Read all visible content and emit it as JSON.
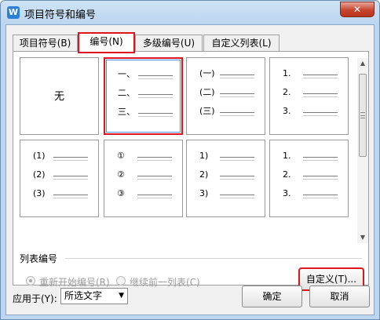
{
  "window": {
    "title": "项目符号和编号",
    "app_icon_glyph": "W",
    "close_glyph": "✕"
  },
  "tabs": [
    {
      "label": "项目符号(B)",
      "active": false
    },
    {
      "label": "编号(N)",
      "active": true
    },
    {
      "label": "多级编号(U)",
      "active": false
    },
    {
      "label": "自定义列表(L)",
      "active": false
    }
  ],
  "gallery": {
    "cells": [
      {
        "none_label": "无",
        "marks": []
      },
      {
        "marks": [
          "一、",
          "二、",
          "三、"
        ],
        "selected": true
      },
      {
        "marks": [
          "(一)",
          "(二)",
          "(三)"
        ]
      },
      {
        "marks": [
          "1.",
          "2.",
          "3."
        ]
      },
      {
        "marks": [
          "(1)",
          "(2)",
          "(3)"
        ]
      },
      {
        "marks": [
          "①",
          "②",
          "③"
        ]
      },
      {
        "marks": [
          "1)",
          "2)",
          "3)"
        ]
      },
      {
        "marks": [
          "1.",
          "2.",
          "3."
        ]
      }
    ]
  },
  "list_numbering": {
    "section_label": "列表编号",
    "restart_label": "重新开始编号(R)",
    "continue_label": "继续前一列表(C)",
    "customize_label": "自定义(T)..."
  },
  "footer": {
    "apply_to_label": "应用于(Y):",
    "apply_to_value": "所选文字",
    "ok_label": "确定",
    "cancel_label": "取消"
  },
  "colors": {
    "highlight_outline": "#e0141e",
    "selection_inner": "#4a90e2"
  }
}
